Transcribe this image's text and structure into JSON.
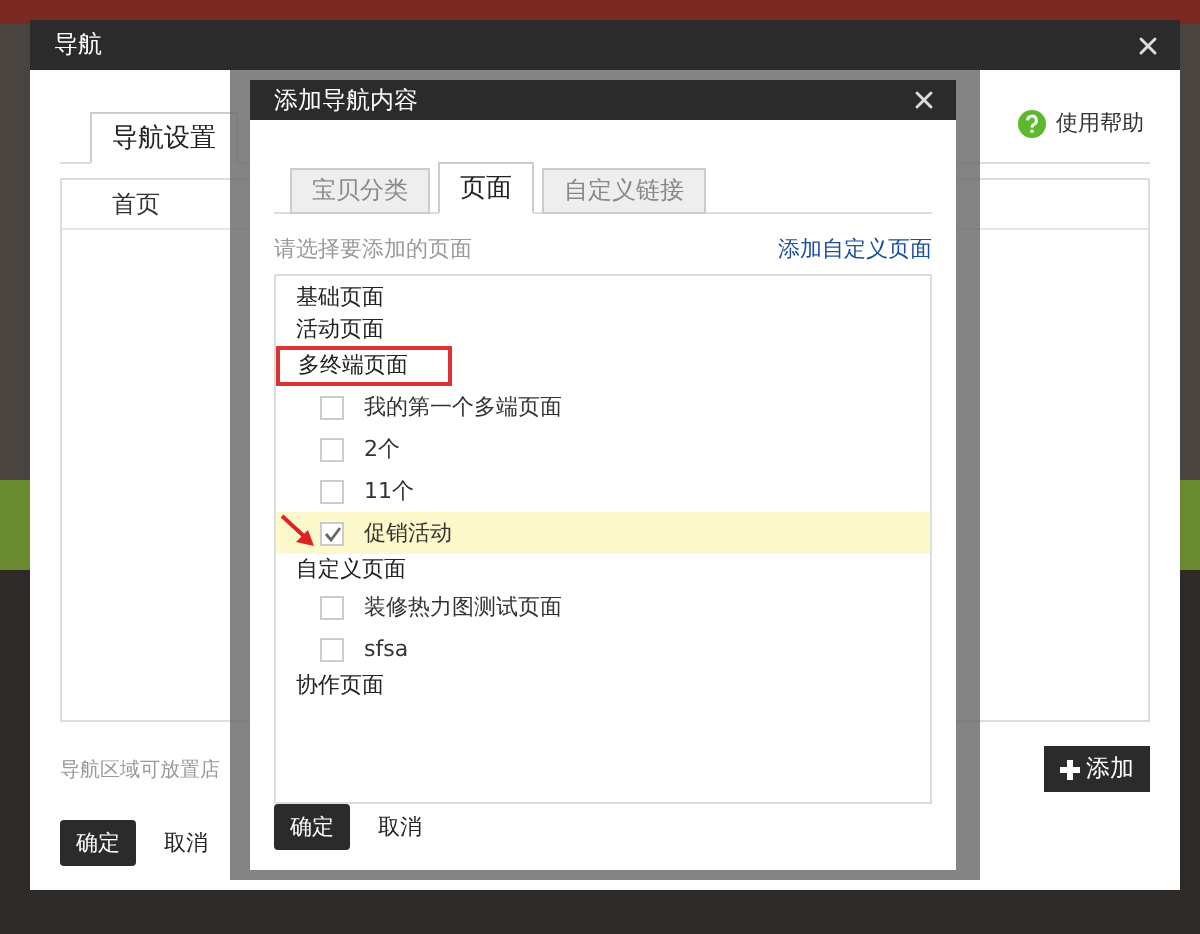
{
  "outer_dialog": {
    "title": "导航",
    "tabs": [
      {
        "label": "导航设置",
        "selected": true
      }
    ],
    "help_link": "使用帮助",
    "nav_items": [
      {
        "label": "首页"
      }
    ],
    "hint": "导航区域可放置店",
    "add_button": "添加",
    "buttons": [
      {
        "label": "确定",
        "kind": "primary"
      },
      {
        "label": "取消",
        "kind": "plain"
      }
    ]
  },
  "add_dialog": {
    "title": "添加导航内容",
    "tabs": [
      {
        "label": "宝贝分类",
        "selected": false
      },
      {
        "label": "页面",
        "selected": true
      },
      {
        "label": "自定义链接",
        "selected": false
      }
    ],
    "instruction": "请选择要添加的页面",
    "add_custom_link": "添加自定义页面",
    "groups": [
      {
        "label": "基础页面",
        "outlined": false
      },
      {
        "label": "活动页面",
        "outlined": false
      },
      {
        "label": "多终端页面",
        "outlined": true,
        "children": [
          {
            "label": "我的第一个多端页面",
            "checked": false,
            "selected": false,
            "pointed": false
          },
          {
            "label": "2个",
            "checked": false,
            "selected": false,
            "pointed": false
          },
          {
            "label": "11个",
            "checked": false,
            "selected": false,
            "pointed": false
          },
          {
            "label": "促销活动",
            "checked": true,
            "selected": true,
            "pointed": true
          }
        ]
      },
      {
        "label": "自定义页面",
        "outlined": false,
        "children": [
          {
            "label": "装修热力图测试页面",
            "checked": false,
            "selected": false,
            "pointed": false
          },
          {
            "label": "sfsa",
            "checked": false,
            "selected": false,
            "pointed": false
          }
        ]
      },
      {
        "label": "协作页面",
        "outlined": false
      }
    ],
    "buttons": [
      {
        "label": "确定",
        "kind": "primary"
      },
      {
        "label": "取消",
        "kind": "plain"
      }
    ]
  }
}
